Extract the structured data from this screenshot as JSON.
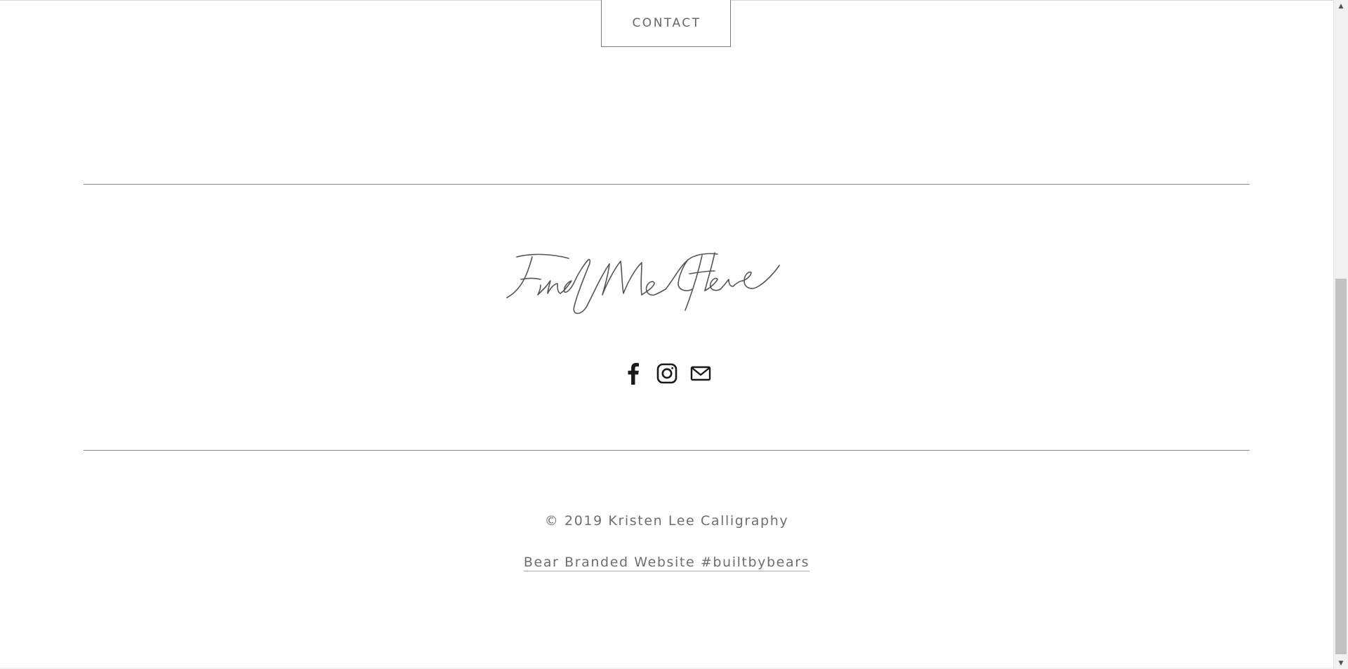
{
  "contact": {
    "label": "CONTACT"
  },
  "footer": {
    "signature_text": "Find Me Here",
    "social_icons": [
      "facebook-icon",
      "instagram-icon",
      "mail-icon"
    ],
    "copyright": "© 2019 Kristen Lee Calligraphy",
    "credit_link": "Bear Branded Website #builtbybears"
  },
  "colors": {
    "text": "#6e6e6e",
    "divider": "#8a8a8a",
    "icon": "#1a1a1a",
    "button_border": "#7a7a7a"
  },
  "scrollbar": {
    "up_arrow": "▲",
    "down_arrow": "▼"
  }
}
